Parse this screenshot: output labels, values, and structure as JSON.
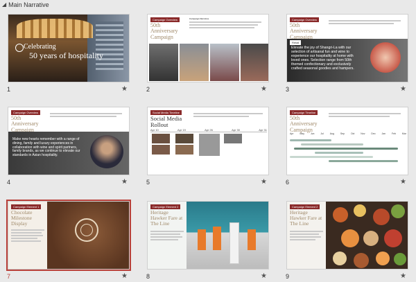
{
  "section": {
    "title": "Main Narrative",
    "collapse_icon": "chevron-down-icon"
  },
  "slides": [
    {
      "number": "1",
      "title_lines": [
        "Celebrating",
        "50 years of hospitality"
      ]
    },
    {
      "number": "2",
      "tag": "Campaign Overview",
      "title": "50th Anniversary Campaign",
      "sub": "Campaign Narrative"
    },
    {
      "number": "3",
      "tag": "Campaign Overview",
      "title": "50th Anniversary Campaign",
      "body": "Elevate the joy of Shangri-La with our selection of artisanal fun and wine to experience our hospitality at home with loved ones. Selection range from 50th themed confectionary and exclusively crafted seasonal goodies and hampers.",
      "badge": "Retail"
    },
    {
      "number": "4",
      "tag": "Campaign Overview",
      "title": "50th Anniversary Campaign",
      "body": "Make new hearts remember with a range of dining, family and luxury experiences in collaboration with wine and spirit partners, family brands, as we continue to elevate our standards in Asian hospitality."
    },
    {
      "number": "5",
      "tag": "Social Media Timeline",
      "title": "Social Media Rollout",
      "months": [
        "Apr 10",
        "Apr 19",
        "Apr 26",
        "Apr 30",
        "Apr 31"
      ]
    },
    {
      "number": "6",
      "tag": "Campaign Timeline",
      "title": "50th Anniversary Campaign",
      "months": [
        "Apr",
        "May",
        "Jun",
        "Jul",
        "Aug",
        "Sep",
        "Oct",
        "Nov",
        "Dec",
        "Jan",
        "Feb",
        "Mar"
      ]
    },
    {
      "number": "7",
      "tag": "Campaign Element 1",
      "title": "Chocolate Milestone Display",
      "selected": true
    },
    {
      "number": "8",
      "tag": "Campaign Element 2",
      "title": "Heritage Hawker Fare at The Line"
    },
    {
      "number": "9",
      "tag": "Campaign Element 2",
      "title": "Heritage Hawker Fare at The Line"
    }
  ],
  "colors": {
    "accent": "#b9403a",
    "brand": "#8a2a2a",
    "gold": "#a08a6a"
  }
}
